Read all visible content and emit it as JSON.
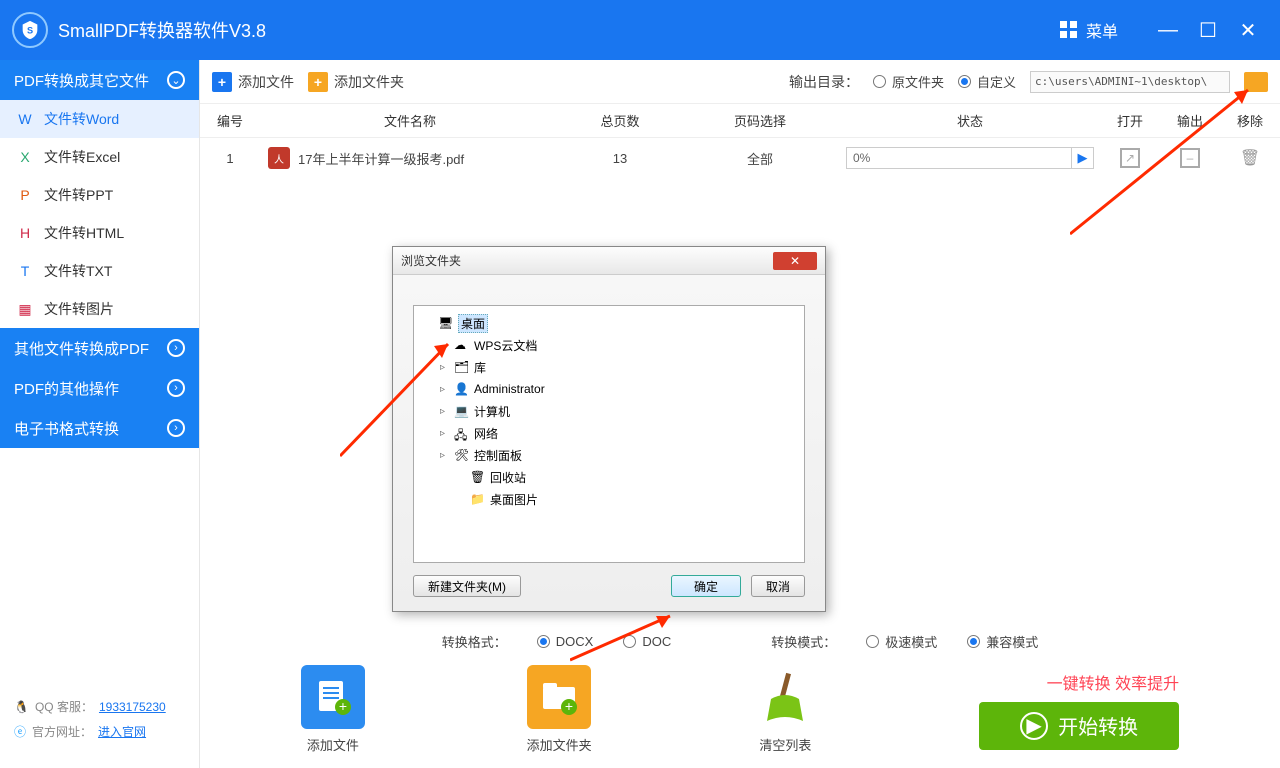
{
  "title": "SmallPDF转换器软件V3.8",
  "menu_label": "菜单",
  "sidebar": {
    "header": "PDF转换成其它文件",
    "items": [
      {
        "label": "文件转Word",
        "color": "#1976f0"
      },
      {
        "label": "文件转Excel",
        "color": "#2aa870"
      },
      {
        "label": "文件转PPT",
        "color": "#e05a10"
      },
      {
        "label": "文件转HTML",
        "color": "#d02a4a"
      },
      {
        "label": "文件转TXT",
        "color": "#1976f0"
      },
      {
        "label": "文件转图片",
        "color": "#d02a4a"
      }
    ],
    "sections": [
      "其他文件转换成PDF",
      "PDF的其他操作",
      "电子书格式转换"
    ]
  },
  "toolbar": {
    "add_file": "添加文件",
    "add_folder": "添加文件夹",
    "output_label": "输出目录：",
    "opt_original": "原文件夹",
    "opt_custom": "自定义",
    "path": "c:\\users\\ADMINI~1\\desktop\\"
  },
  "table": {
    "headers": {
      "num": "编号",
      "name": "文件名称",
      "pages": "总页数",
      "range": "页码选择",
      "status": "状态",
      "open": "打开",
      "output": "输出",
      "remove": "移除"
    },
    "rows": [
      {
        "num": "1",
        "name": "17年上半年计算一级报考.pdf",
        "pages": "13",
        "range": "全部",
        "status": "0%"
      }
    ]
  },
  "format_row": {
    "format_label": "转换格式：",
    "docx": "DOCX",
    "doc": "DOC",
    "mode_label": "转换模式：",
    "fast": "极速模式",
    "compat": "兼容模式"
  },
  "big_buttons": {
    "add_file": "添加文件",
    "add_folder": "添加文件夹",
    "clear": "清空列表"
  },
  "slogan": "一键转换  效率提升",
  "start": "开始转换",
  "footer": {
    "qq_label": "QQ 客服：",
    "qq": "1933175230",
    "site_label": "官方网址：",
    "site": "进入官网"
  },
  "dialog": {
    "title": "浏览文件夹",
    "tree": [
      "桌面",
      "WPS云文档",
      "库",
      "Administrator",
      "计算机",
      "网络",
      "控制面板",
      "回收站",
      "桌面图片"
    ],
    "new_folder": "新建文件夹(M)",
    "ok": "确定",
    "cancel": "取消"
  }
}
